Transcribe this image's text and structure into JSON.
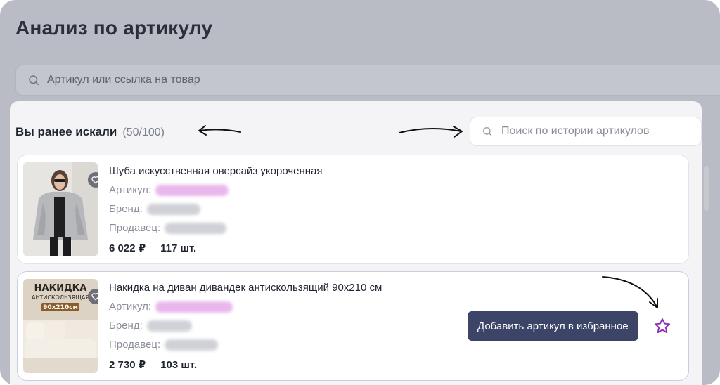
{
  "page": {
    "title": "Анализ по артикулу"
  },
  "main_search": {
    "placeholder": "Артикул или ссылка на товар",
    "icon": "search-icon"
  },
  "history": {
    "title": "Вы ранее искали",
    "count": "(50/100)",
    "search_placeholder": "Поиск по истории артикулов"
  },
  "products": [
    {
      "title": "Шуба искусственная оверсайз укороченная",
      "article_label": "Артикул:",
      "brand_label": "Бренд:",
      "seller_label": "Продавец:",
      "price": "6 022 ₽",
      "quantity": "117 шт.",
      "favorite_icon": "heart-icon"
    },
    {
      "title": "Накидка на диван дивандек антискользящий 90х210 см",
      "article_label": "Артикул:",
      "brand_label": "Бренд:",
      "seller_label": "Продавец:",
      "price": "2 730 ₽",
      "quantity": "103 шт.",
      "favorite_icon": "heart-icon",
      "image_text_main": "НАКИДКА",
      "image_text_sub": "АНТИСКОЛЬЗЯЩАЯ",
      "image_text_size": "90х210см"
    }
  ],
  "tooltip": {
    "text": "Добавить артикул в избранное"
  },
  "colors": {
    "overlay": "#b9bcc4",
    "tooltip_bg": "#3c4567",
    "star": "#8e2fb0",
    "blur_pink": "#e9b7ec"
  }
}
